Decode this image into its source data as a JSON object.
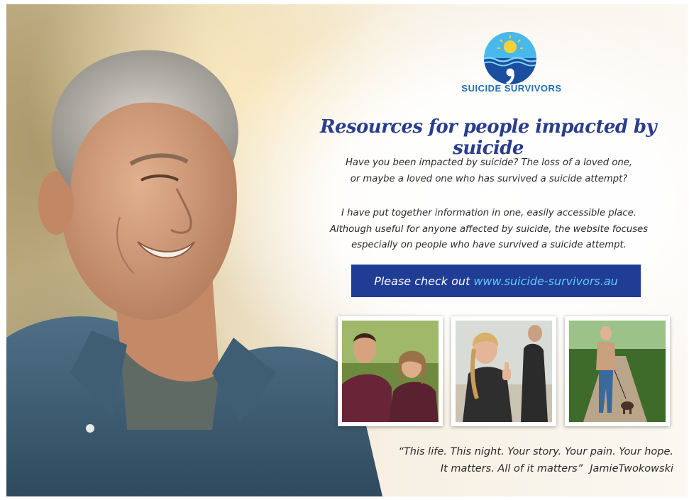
{
  "logo": {
    "name": "SUICIDE SURVIVORS",
    "icon": "sun-over-water-comma-icon"
  },
  "headline": "Resources for people impacted by suicide",
  "intro": {
    "line1": "Have you been impacted by suicide? The loss of a loved one,",
    "line2": "or maybe a loved one who has survived a suicide attempt?"
  },
  "about": {
    "line1": "I have put together information in one, easily accessible place.",
    "line2": "Although useful for anyone affected by suicide, the website focuses",
    "line3": "especially on people who have survived a suicide attempt."
  },
  "cta": {
    "prefix": "Please check out",
    "url": "www.suicide-survivors.au"
  },
  "quote": {
    "line1": "“This life. This night. Your story. Your pain. Your hope.",
    "line2": "It matters. All of it matters”",
    "author": "JamieTwokowski"
  },
  "colors": {
    "headline": "#2a3e8e",
    "cta_background": "#1f3d95",
    "cta_url": "#63c8f2",
    "logo_text": "#1f6fb6"
  }
}
